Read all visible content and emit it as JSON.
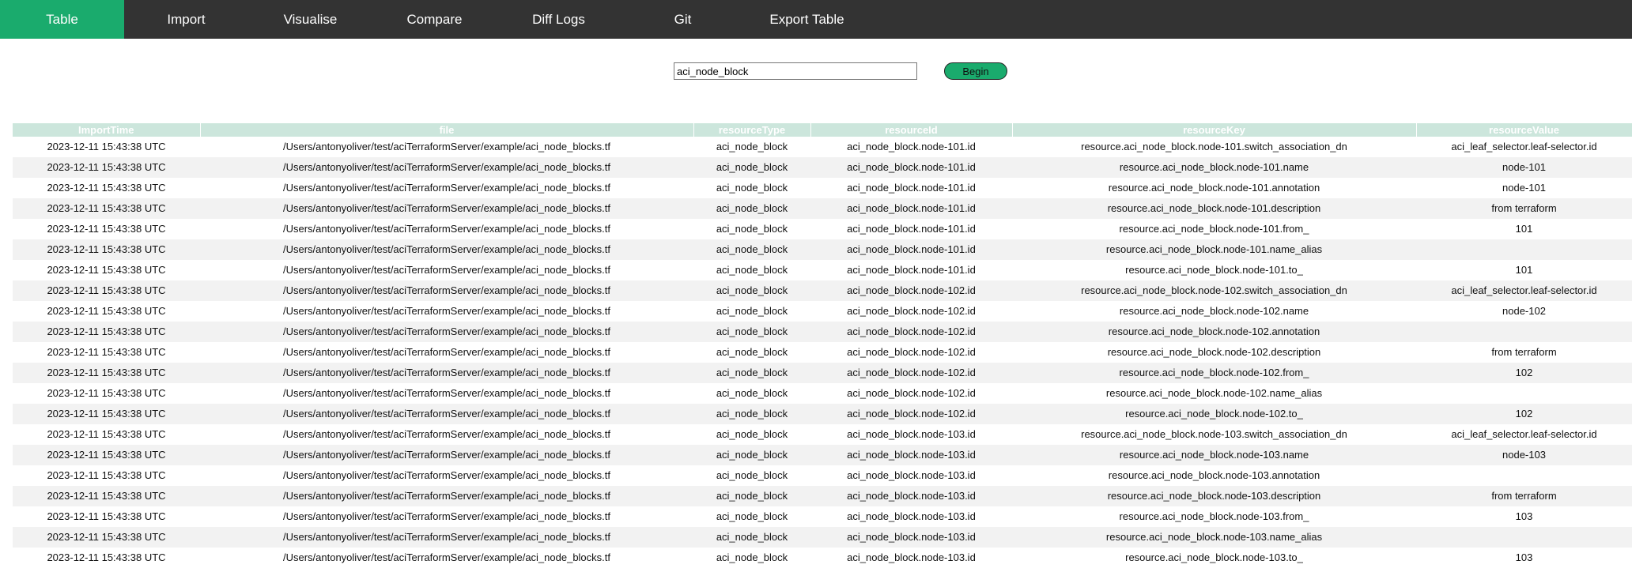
{
  "nav": {
    "items": [
      {
        "label": "Table",
        "active": true
      },
      {
        "label": "Import",
        "active": false
      },
      {
        "label": "Visualise",
        "active": false
      },
      {
        "label": "Compare",
        "active": false
      },
      {
        "label": "Diff Logs",
        "active": false
      },
      {
        "label": "Git",
        "active": false
      },
      {
        "label": "Export Table",
        "active": false
      }
    ]
  },
  "search": {
    "value": "aci_node_block",
    "button_label": "Begin"
  },
  "colors": {
    "accent": "#1aab6d",
    "navbar": "#333333",
    "header_bg": "#cce6dc",
    "row_alt": "#f2f2f2"
  },
  "table": {
    "columns": [
      "ImportTime",
      "file",
      "resourceType",
      "resourceId",
      "resourceKey",
      "resourceValue"
    ],
    "rows": [
      [
        "2023-12-11 15:43:38 UTC",
        "/Users/antonyoliver/test/aciTerraformServer/example/aci_node_blocks.tf",
        "aci_node_block",
        "aci_node_block.node-101.id",
        "resource.aci_node_block.node-101.switch_association_dn",
        "aci_leaf_selector.leaf-selector.id"
      ],
      [
        "2023-12-11 15:43:38 UTC",
        "/Users/antonyoliver/test/aciTerraformServer/example/aci_node_blocks.tf",
        "aci_node_block",
        "aci_node_block.node-101.id",
        "resource.aci_node_block.node-101.name",
        "node-101"
      ],
      [
        "2023-12-11 15:43:38 UTC",
        "/Users/antonyoliver/test/aciTerraformServer/example/aci_node_blocks.tf",
        "aci_node_block",
        "aci_node_block.node-101.id",
        "resource.aci_node_block.node-101.annotation",
        "node-101"
      ],
      [
        "2023-12-11 15:43:38 UTC",
        "/Users/antonyoliver/test/aciTerraformServer/example/aci_node_blocks.tf",
        "aci_node_block",
        "aci_node_block.node-101.id",
        "resource.aci_node_block.node-101.description",
        "from terraform"
      ],
      [
        "2023-12-11 15:43:38 UTC",
        "/Users/antonyoliver/test/aciTerraformServer/example/aci_node_blocks.tf",
        "aci_node_block",
        "aci_node_block.node-101.id",
        "resource.aci_node_block.node-101.from_",
        "101"
      ],
      [
        "2023-12-11 15:43:38 UTC",
        "/Users/antonyoliver/test/aciTerraformServer/example/aci_node_blocks.tf",
        "aci_node_block",
        "aci_node_block.node-101.id",
        "resource.aci_node_block.node-101.name_alias",
        ""
      ],
      [
        "2023-12-11 15:43:38 UTC",
        "/Users/antonyoliver/test/aciTerraformServer/example/aci_node_blocks.tf",
        "aci_node_block",
        "aci_node_block.node-101.id",
        "resource.aci_node_block.node-101.to_",
        "101"
      ],
      [
        "2023-12-11 15:43:38 UTC",
        "/Users/antonyoliver/test/aciTerraformServer/example/aci_node_blocks.tf",
        "aci_node_block",
        "aci_node_block.node-102.id",
        "resource.aci_node_block.node-102.switch_association_dn",
        "aci_leaf_selector.leaf-selector.id"
      ],
      [
        "2023-12-11 15:43:38 UTC",
        "/Users/antonyoliver/test/aciTerraformServer/example/aci_node_blocks.tf",
        "aci_node_block",
        "aci_node_block.node-102.id",
        "resource.aci_node_block.node-102.name",
        "node-102"
      ],
      [
        "2023-12-11 15:43:38 UTC",
        "/Users/antonyoliver/test/aciTerraformServer/example/aci_node_blocks.tf",
        "aci_node_block",
        "aci_node_block.node-102.id",
        "resource.aci_node_block.node-102.annotation",
        ""
      ],
      [
        "2023-12-11 15:43:38 UTC",
        "/Users/antonyoliver/test/aciTerraformServer/example/aci_node_blocks.tf",
        "aci_node_block",
        "aci_node_block.node-102.id",
        "resource.aci_node_block.node-102.description",
        "from terraform"
      ],
      [
        "2023-12-11 15:43:38 UTC",
        "/Users/antonyoliver/test/aciTerraformServer/example/aci_node_blocks.tf",
        "aci_node_block",
        "aci_node_block.node-102.id",
        "resource.aci_node_block.node-102.from_",
        "102"
      ],
      [
        "2023-12-11 15:43:38 UTC",
        "/Users/antonyoliver/test/aciTerraformServer/example/aci_node_blocks.tf",
        "aci_node_block",
        "aci_node_block.node-102.id",
        "resource.aci_node_block.node-102.name_alias",
        ""
      ],
      [
        "2023-12-11 15:43:38 UTC",
        "/Users/antonyoliver/test/aciTerraformServer/example/aci_node_blocks.tf",
        "aci_node_block",
        "aci_node_block.node-102.id",
        "resource.aci_node_block.node-102.to_",
        "102"
      ],
      [
        "2023-12-11 15:43:38 UTC",
        "/Users/antonyoliver/test/aciTerraformServer/example/aci_node_blocks.tf",
        "aci_node_block",
        "aci_node_block.node-103.id",
        "resource.aci_node_block.node-103.switch_association_dn",
        "aci_leaf_selector.leaf-selector.id"
      ],
      [
        "2023-12-11 15:43:38 UTC",
        "/Users/antonyoliver/test/aciTerraformServer/example/aci_node_blocks.tf",
        "aci_node_block",
        "aci_node_block.node-103.id",
        "resource.aci_node_block.node-103.name",
        "node-103"
      ],
      [
        "2023-12-11 15:43:38 UTC",
        "/Users/antonyoliver/test/aciTerraformServer/example/aci_node_blocks.tf",
        "aci_node_block",
        "aci_node_block.node-103.id",
        "resource.aci_node_block.node-103.annotation",
        ""
      ],
      [
        "2023-12-11 15:43:38 UTC",
        "/Users/antonyoliver/test/aciTerraformServer/example/aci_node_blocks.tf",
        "aci_node_block",
        "aci_node_block.node-103.id",
        "resource.aci_node_block.node-103.description",
        "from terraform"
      ],
      [
        "2023-12-11 15:43:38 UTC",
        "/Users/antonyoliver/test/aciTerraformServer/example/aci_node_blocks.tf",
        "aci_node_block",
        "aci_node_block.node-103.id",
        "resource.aci_node_block.node-103.from_",
        "103"
      ],
      [
        "2023-12-11 15:43:38 UTC",
        "/Users/antonyoliver/test/aciTerraformServer/example/aci_node_blocks.tf",
        "aci_node_block",
        "aci_node_block.node-103.id",
        "resource.aci_node_block.node-103.name_alias",
        ""
      ],
      [
        "2023-12-11 15:43:38 UTC",
        "/Users/antonyoliver/test/aciTerraformServer/example/aci_node_blocks.tf",
        "aci_node_block",
        "aci_node_block.node-103.id",
        "resource.aci_node_block.node-103.to_",
        "103"
      ]
    ]
  }
}
